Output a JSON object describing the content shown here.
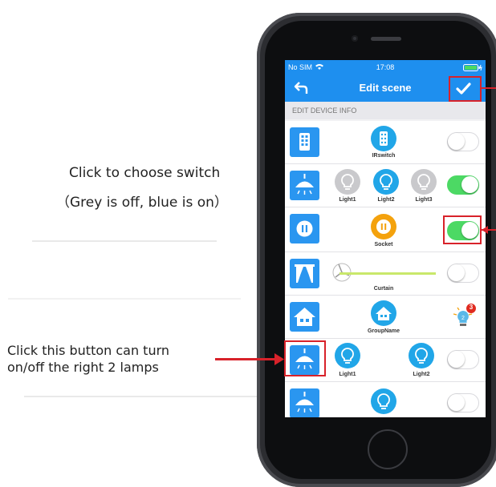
{
  "annotations": {
    "choose_switch": "Click to choose switch",
    "grey_blue": "（Grey is off, blue is on）",
    "turn_line1": "Click this button can turn",
    "turn_line2": "on/off the right 2 lamps"
  },
  "status_bar": {
    "carrier": "No SIM",
    "time": "17:08"
  },
  "nav": {
    "title": "Edit scene",
    "back_icon": "back-arrow-icon",
    "confirm_icon": "checkmark-icon"
  },
  "section_header": "EDIT DEVICE INFO",
  "rows": [
    {
      "icon": "irswitch-icon",
      "items": [
        "IRswitch"
      ],
      "on": false
    },
    {
      "icon": "ceiling-lamp-icon",
      "items": [
        "Light1",
        "Light2",
        "Light3"
      ],
      "states": [
        "off",
        "on",
        "off"
      ],
      "on": true
    },
    {
      "icon": "socket-icon",
      "items": [
        "Socket"
      ],
      "on": true
    },
    {
      "icon": "curtain-icon",
      "items": [
        "Curtain"
      ],
      "on": false
    },
    {
      "icon": "house-icon",
      "items": [
        "GroupName"
      ],
      "badge": "3"
    },
    {
      "icon": "ceiling-lamp-icon",
      "items": [
        "Light1",
        "Light2"
      ],
      "on": false
    },
    {
      "icon": "ceiling-lamp-icon",
      "items": [],
      "on": false
    }
  ],
  "colors": {
    "nav_blue": "#1e8fef",
    "toggle_on": "#4cd964",
    "highlight_red": "#d8222a",
    "badge_red": "#e02b20"
  }
}
